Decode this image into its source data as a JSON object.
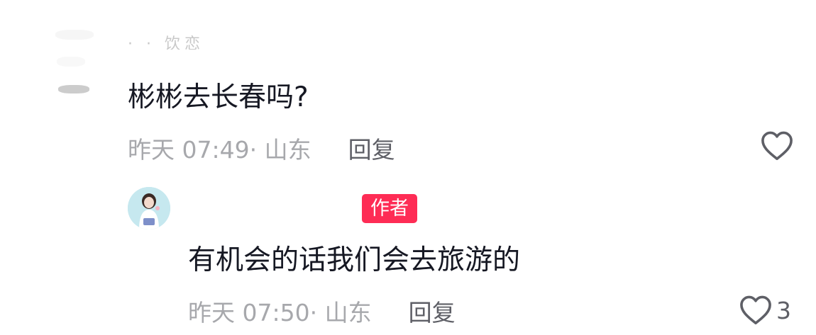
{
  "comment": {
    "username": "· · 饮恋",
    "text": "彬彬去长春吗?",
    "time_location": "昨天 07:49· 山东",
    "reply_label": "回复",
    "like_count": ""
  },
  "reply": {
    "badge": "作者",
    "text": "有机会的话我们会去旅游的",
    "time_location": "昨天 07:50· 山东",
    "reply_label": "回复",
    "like_count": "3"
  },
  "colors": {
    "text_primary": "#161823",
    "text_secondary": "#a7a8ac",
    "reply_action": "#5e5f66",
    "author_badge": "#fe2c55",
    "icon": "#5e5f66"
  },
  "icons": {
    "like": "heart-outline-icon"
  }
}
